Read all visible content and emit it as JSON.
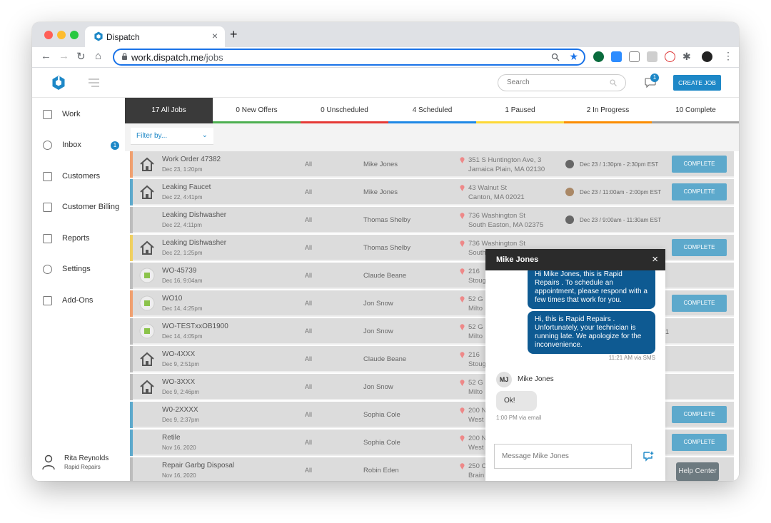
{
  "browser": {
    "tab_title": "Dispatch",
    "tab_close": "×",
    "new_tab": "+",
    "url_host": "work.dispatch.me",
    "url_path": "/jobs"
  },
  "header": {
    "search_placeholder": "Search",
    "chat_badge": "1",
    "create_job": "CREATE JOB"
  },
  "sidebar": {
    "items": [
      {
        "label": "Work",
        "icon": "calendar-icon"
      },
      {
        "label": "Inbox",
        "icon": "chat-icon",
        "badge": "1"
      },
      {
        "label": "Customers",
        "icon": "customers-icon"
      },
      {
        "label": "Customer Billing",
        "icon": "billing-icon"
      },
      {
        "label": "Reports",
        "icon": "reports-icon"
      },
      {
        "label": "Settings",
        "icon": "gear-icon"
      },
      {
        "label": "Add-Ons",
        "icon": "store-icon"
      }
    ],
    "user": {
      "name": "Rita Reynolds",
      "company": "Rapid Repairs"
    }
  },
  "tabs": [
    {
      "label": "17 All Jobs",
      "color": "#3a3a3a"
    },
    {
      "label": "0 New Offers",
      "color": "#4caf50"
    },
    {
      "label": "0 Unscheduled",
      "color": "#e53935"
    },
    {
      "label": "4 Scheduled",
      "color": "#1e88e5"
    },
    {
      "label": "1 Paused",
      "color": "#fdd835"
    },
    {
      "label": "2 In Progress",
      "color": "#fb8c00"
    },
    {
      "label": "10 Complete",
      "color": "#9e9e9e"
    }
  ],
  "filter": {
    "label": "Filter by..."
  },
  "jobs": [
    {
      "title": "Work Order 47382",
      "date": "Dec 23, 1:20pm",
      "all": "All",
      "tech": "Mike Jones",
      "addr1": "351 S Huntington Ave, 3",
      "addr2": "Jamaica Plain, MA 02130",
      "sched": "Dec 23 / 1:30pm - 2:30pm EST",
      "action": "COMPLETE",
      "icon": "house"
    },
    {
      "title": "Leaking Faucet",
      "date": "Dec 22, 4:41pm",
      "all": "All",
      "tech": "Mike Jones",
      "addr1": "43 Walnut St",
      "addr2": "Canton, MA 02021",
      "sched": "Dec 23 / 11:00am - 2:00pm EST",
      "action": "COMPLETE",
      "icon": "house"
    },
    {
      "title": "Leaking Dishwasher",
      "date": "Dec 22, 4:11pm",
      "all": "All",
      "tech": "Thomas Shelby",
      "addr1": "736 Washington St",
      "addr2": "South Easton, MA 02375",
      "sched": "Dec 23 / 9:00am - 11:30am EST",
      "action": "",
      "icon": ""
    },
    {
      "title": "Leaking Dishwasher",
      "date": "Dec 22, 1:25pm",
      "all": "All",
      "tech": "Thomas Shelby",
      "addr1": "736 Washington St",
      "addr2": "South",
      "sched": "",
      "action": "COMPLETE",
      "icon": "house"
    },
    {
      "title": "WO-45739",
      "date": "Dec 16, 9:04am",
      "all": "All",
      "tech": "Claude Beane",
      "addr1": "216",
      "addr2": "Stoug",
      "sched": "",
      "action": "",
      "icon": "doc"
    },
    {
      "title": "WO10",
      "date": "Dec 14, 4:25pm",
      "all": "All",
      "tech": "Jon Snow",
      "addr1": "52 G",
      "addr2": "Milto",
      "sched": "",
      "action": "COMPLETE",
      "icon": "doc"
    },
    {
      "title": "WO-TESTxxOB1900",
      "date": "Dec 14, 4:05pm",
      "all": "All",
      "tech": "Jon Snow",
      "addr1": "52 G",
      "addr2": "Milto",
      "sched": "1",
      "action": "",
      "icon": "doc"
    },
    {
      "title": "WO-4XXX",
      "date": "Dec 9, 2:51pm",
      "all": "All",
      "tech": "Claude Beane",
      "addr1": "216",
      "addr2": "Stoug",
      "sched": "",
      "action": "",
      "icon": "house"
    },
    {
      "title": "WO-3XXX",
      "date": "Dec 9, 2:46pm",
      "all": "All",
      "tech": "Jon Snow",
      "addr1": "52 G",
      "addr2": "Milto",
      "sched": "",
      "action": "",
      "icon": "house"
    },
    {
      "title": "W0-2XXXX",
      "date": "Dec 9, 2:37pm",
      "all": "All",
      "tech": "Sophia Cole",
      "addr1": "200 N",
      "addr2": "West",
      "sched": "",
      "action": "COMPLETE",
      "icon": ""
    },
    {
      "title": "Retile",
      "date": "Nov 16, 2020",
      "all": "All",
      "tech": "Sophia Cole",
      "addr1": "200 N",
      "addr2": "West",
      "sched": "",
      "action": "COMPLETE",
      "icon": ""
    },
    {
      "title": "Repair Garbg Disposal",
      "date": "Nov 16, 2020",
      "all": "All",
      "tech": "Robin Eden",
      "addr1": "250 C",
      "addr2": "Brain",
      "sched": "",
      "action": "",
      "icon": ""
    }
  ],
  "chat": {
    "title": "Mike Jones",
    "close": "×",
    "msg1": "Hi Mike Jones, this is Rapid Repairs . To schedule an appointment, please respond with a few times that work for you.",
    "msg2": "Hi, this is Rapid Repairs . Unfortunately, your technician is running late. We apologize for the inconvenience.",
    "msg2_meta": "11:21 AM via SMS",
    "reply_initials": "MJ",
    "reply_name": "Mike Jones",
    "reply_text": "Ok!",
    "reply_meta": "1:00 PM via email",
    "input_placeholder": "Message Mike Jones"
  },
  "help": {
    "label": "Help Center"
  },
  "colors": {
    "accent": "#1e88c7",
    "complete": "#5da9cc",
    "dark": "#2b2b2b",
    "bubble": "#0e5a92"
  }
}
